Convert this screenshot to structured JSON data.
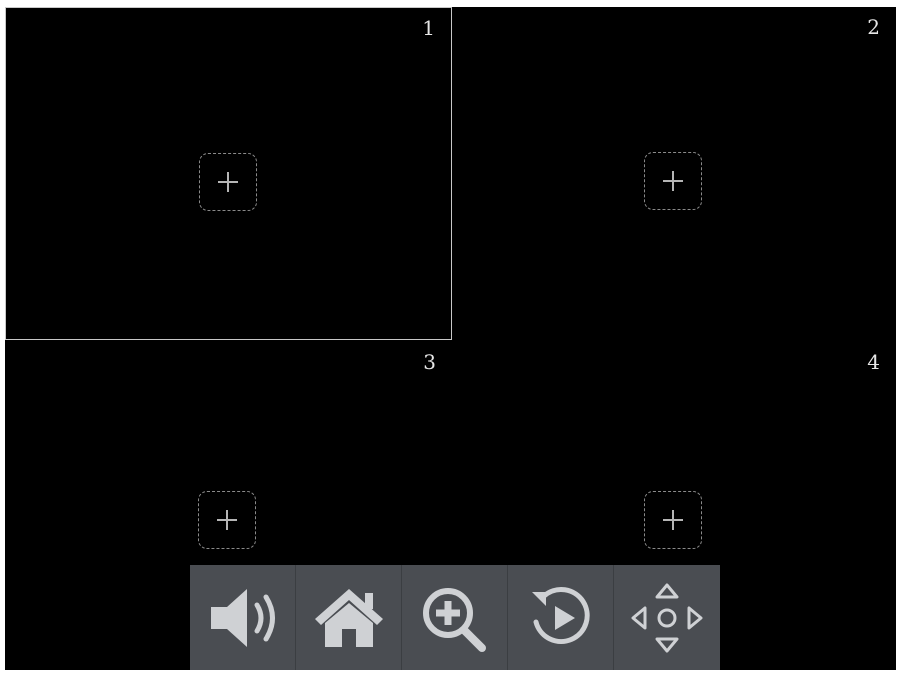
{
  "panes": [
    {
      "number": "1",
      "selected": true,
      "icon": "plus-icon"
    },
    {
      "number": "2",
      "selected": false,
      "icon": "plus-icon"
    },
    {
      "number": "3",
      "selected": false,
      "icon": "plus-icon"
    },
    {
      "number": "4",
      "selected": false,
      "icon": "plus-icon"
    }
  ],
  "toolbar": {
    "buttons": [
      {
        "icon": "speaker-icon"
      },
      {
        "icon": "home-icon"
      },
      {
        "icon": "zoom-in-icon"
      },
      {
        "icon": "playback-icon"
      },
      {
        "icon": "ptz-direction-icon"
      }
    ]
  },
  "colors": {
    "background": "#000000",
    "pane_number": "#e6e6e6",
    "selected_border": "#c8c8c8",
    "add_box_border": "#8a8a8a",
    "toolbar_bg": "#4a4d52",
    "toolbar_icon": "#cfd1d4"
  }
}
